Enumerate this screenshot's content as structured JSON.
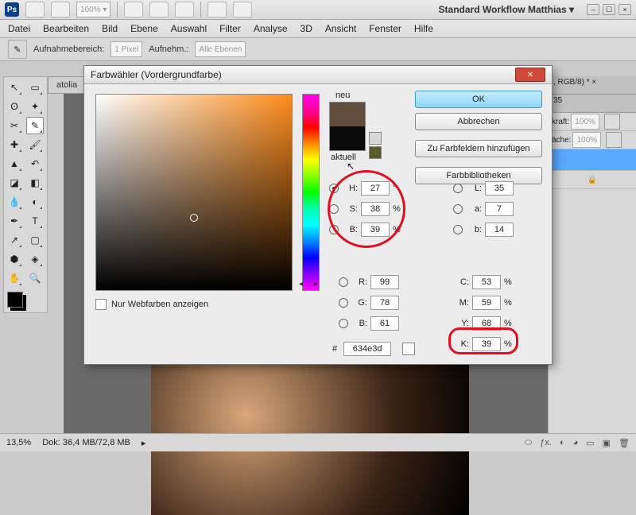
{
  "app": {
    "logo_text": "Ps",
    "workflow": "Standard Workflow Matthias ▾",
    "zoom_tb": "100% ▾"
  },
  "menus": [
    "Datei",
    "Bearbeiten",
    "Bild",
    "Ebene",
    "Auswahl",
    "Filter",
    "Analyse",
    "3D",
    "Ansicht",
    "Fenster",
    "Hilfe"
  ],
  "opts": {
    "label1": "Aufnahmebereich:",
    "val1": "1 Pixel",
    "label2": "Aufnehm.:",
    "val2": "Alle Ebenen"
  },
  "doc_tab_left": "atolia",
  "doc_tab_right": ", RGB/8) *  ×",
  "right": {
    "tab": "35",
    "kraft": "kraft:",
    "kraft_v": "100%",
    "flache": "äche:",
    "flache_v": "100%"
  },
  "status": {
    "pct": "13,5%",
    "doc": "Dok: 36,4 MB/72,8 MB"
  },
  "dlg": {
    "title": "Farbwähler (Vordergrundfarbe)",
    "neu": "neu",
    "aktuell": "aktuell",
    "btns": {
      "ok": "OK",
      "cancel": "Abbrechen",
      "add": "Zu Farbfeldern hinzufügen",
      "lib": "Farbbibliotheken"
    },
    "web": "Nur Webfarben anzeigen",
    "hex_lbl": "#",
    "hex": "634e3d",
    "H": {
      "l": "H:",
      "v": "27",
      "u": "°"
    },
    "S": {
      "l": "S:",
      "v": "38",
      "u": "%"
    },
    "B": {
      "l": "B:",
      "v": "39",
      "u": "%"
    },
    "R": {
      "l": "R:",
      "v": "99",
      "u": ""
    },
    "G": {
      "l": "G:",
      "v": "78",
      "u": ""
    },
    "Bb": {
      "l": "B:",
      "v": "61",
      "u": ""
    },
    "L": {
      "l": "L:",
      "v": "35",
      "u": ""
    },
    "a": {
      "l": "a:",
      "v": "7",
      "u": ""
    },
    "b2": {
      "l": "b:",
      "v": "14",
      "u": ""
    },
    "C": {
      "l": "C:",
      "v": "53",
      "u": "%"
    },
    "M": {
      "l": "M:",
      "v": "59",
      "u": "%"
    },
    "Y": {
      "l": "Y:",
      "v": "68",
      "u": "%"
    },
    "K": {
      "l": "K:",
      "v": "39",
      "u": "%"
    }
  }
}
